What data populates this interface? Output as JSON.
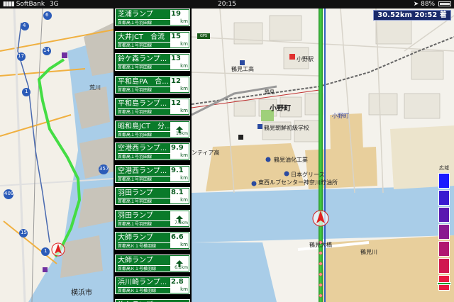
{
  "status_bar": {
    "carrier": "SoftBank",
    "network": "3G",
    "time": "20:15",
    "battery_percent": "88%"
  },
  "info_box": {
    "distance": "30.52km",
    "eta": "20:52",
    "eta_suffix": "着"
  },
  "route_items": [
    {
      "name": "芝浦ランプ",
      "sub": "首都高１号羽田線",
      "dist": "19",
      "unit": "km",
      "kind": "ramp"
    },
    {
      "name": "大井JCT　合流",
      "sub": "首都高１号羽田線",
      "dist": "15",
      "unit": "km",
      "kind": "ramp"
    },
    {
      "name": "鈴ケ森ランプ...",
      "sub": "首都高１号羽田線",
      "dist": "13",
      "unit": "km",
      "kind": "ramp"
    },
    {
      "name": "平和島PA　合...",
      "sub": "首都高１号羽田線",
      "dist": "12",
      "unit": "km",
      "kind": "ramp"
    },
    {
      "name": "平和島ランプ...",
      "sub": "首都高１号羽田線",
      "dist": "12",
      "unit": "km",
      "kind": "ramp"
    },
    {
      "name": "昭和島JCT　分...",
      "sub": "首都高１号羽田線",
      "dist": "10km",
      "unit": "",
      "kind": "straight"
    },
    {
      "name": "空港西ランプ...",
      "sub": "首都高１号羽田線",
      "dist": "9.9",
      "unit": "km",
      "kind": "ramp"
    },
    {
      "name": "空港西ランプ...",
      "sub": "首都高１号羽田線",
      "dist": "9.1",
      "unit": "km",
      "kind": "ramp"
    },
    {
      "name": "羽田ランプ",
      "sub": "首都高１号羽田線",
      "dist": "8.1",
      "unit": "km",
      "kind": "ramp"
    },
    {
      "name": "羽田ランプ",
      "sub": "首都高１号羽田線",
      "dist": "7.6km",
      "unit": "",
      "kind": "straight"
    },
    {
      "name": "大師ランプ",
      "sub": "首都高Ｋ１号横羽線",
      "dist": "6.6",
      "unit": "km",
      "kind": "ramp"
    },
    {
      "name": "大師ランプ",
      "sub": "首都高Ｋ１号横羽線",
      "dist": "6.1km",
      "unit": "",
      "kind": "straight"
    },
    {
      "name": "浜川崎ランプ...",
      "sub": "首都高Ｋ１号横羽線",
      "dist": "2.8",
      "unit": "km",
      "kind": "ramp"
    },
    {
      "name": "汐入ランプ",
      "sub": "",
      "dist": "",
      "unit": "",
      "kind": "ramp"
    }
  ],
  "overview_map": {
    "labels": {
      "route6": "6",
      "route4": "4",
      "route17": "17",
      "route14": "14",
      "route1a": "1",
      "route357": "357",
      "route409": "409",
      "route15": "15",
      "route1b": "1",
      "arakawa": "荒川",
      "yokohama": "横浜市"
    }
  },
  "main_map": {
    "labels": {
      "gps": "GPS",
      "tsurumi_high": "鶴見工高",
      "onoeki": "小野駅",
      "tsurumi": "鶴見",
      "onomachi": "小野町",
      "onomachi_blue": "小野町",
      "korean_school": "鶴見朝鮮初級学校",
      "frontier_high": "ンティア高",
      "tsurumi_oil": "鶴見油化工業",
      "nihon_grease": "日本グリース",
      "tozai_lube": "東西ルブセンター神奈川貯油所",
      "tsurumi_bridge": "鶴見大橋",
      "tsurumi_river": "鶴見川"
    }
  },
  "scale": {
    "label": "広域",
    "colors": [
      "#1a1aff",
      "#3a1ad0",
      "#5a18b0",
      "#8a1890",
      "#b01870",
      "#d01850",
      "#e81840"
    ]
  }
}
